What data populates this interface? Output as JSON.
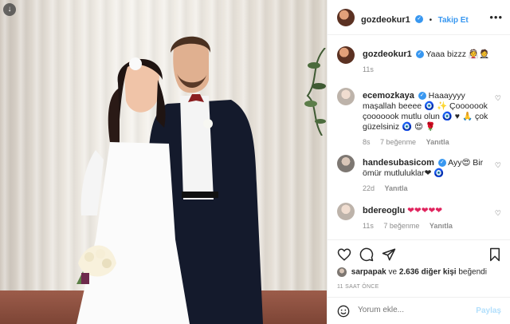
{
  "header": {
    "username": "gozdeokur1",
    "separator": "•",
    "follow_label": "Takip Et",
    "more_icon": "more-horizontal-icon"
  },
  "caption": {
    "username": "gozdeokur1",
    "text": "Yaaa bizzz 👰🤵",
    "time": "11s"
  },
  "comments": [
    {
      "username": "ecemozkaya",
      "text": "Haaayyyy maşallah beeee 🧿 ✨ Çooooook çooooook mutlu olun 🧿 ♥ 🙏 çok güzelsiniz 🧿 😍 🌹",
      "time": "8s",
      "likes": "7 beğenme",
      "reply": "Yanıtla"
    },
    {
      "username": "handesubasicom",
      "text": "Ayy😍 Bir ömür mutluluklar❤ 🧿",
      "time": "22d",
      "likes": "",
      "reply": "Yanıtla"
    },
    {
      "username": "bdereoglu",
      "text": "❤❤❤❤❤",
      "time": "11s",
      "likes": "7 beğenme",
      "reply": "Yanıtla"
    }
  ],
  "likes": {
    "user": "sarpapak",
    "connector": "ve",
    "count_text": "2.636 diğer kişi",
    "suffix": "beğendi"
  },
  "timestamp": "11 SAAT ÖNCE",
  "add_comment": {
    "placeholder": "Yorum ekle...",
    "post_label": "Paylaş"
  },
  "icons": {
    "heart": "heart-icon",
    "comment": "comment-icon",
    "share": "share-icon",
    "save": "bookmark-icon",
    "emoji": "emoji-icon"
  },
  "colors": {
    "accent": "#3897f0",
    "post_disabled": "#b2dffc",
    "meta": "#8e8e8e"
  }
}
